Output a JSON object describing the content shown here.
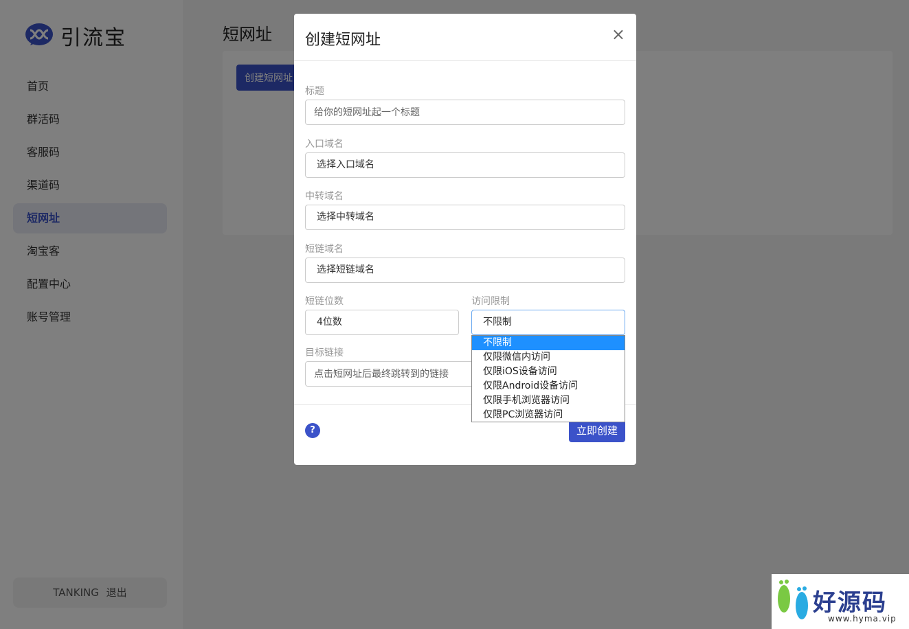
{
  "app": {
    "logo_text": "引流宝",
    "logo_colors": [
      "#3b52c9",
      "#1e2f8a"
    ]
  },
  "sidebar": {
    "items": [
      {
        "label": "首页"
      },
      {
        "label": "群活码"
      },
      {
        "label": "客服码"
      },
      {
        "label": "渠道码"
      },
      {
        "label": "短网址",
        "active": true
      },
      {
        "label": "淘宝客"
      },
      {
        "label": "配置中心"
      },
      {
        "label": "账号管理"
      }
    ],
    "user": {
      "name": "TANKING",
      "logout": "退出"
    }
  },
  "main": {
    "title": "短网址",
    "create_button": "创建短网址"
  },
  "modal": {
    "title": "创建短网址",
    "close_glyph": "×",
    "fields": {
      "title": {
        "label": "标题",
        "placeholder": "给你的短网址起一个标题"
      },
      "entry_domain": {
        "label": "入口域名",
        "value": "选择入口域名"
      },
      "transit_domain": {
        "label": "中转域名",
        "value": "选择中转域名"
      },
      "short_domain": {
        "label": "短链域名",
        "value": "选择短链域名"
      },
      "digits": {
        "label": "短链位数",
        "value": "4位数"
      },
      "access_limit": {
        "label": "访问限制",
        "value": "不限制",
        "options": [
          "不限制",
          "仅限微信内访问",
          "仅限iOS设备访问",
          "仅限Android设备访问",
          "仅限手机浏览器访问",
          "仅限PC浏览器访问"
        ]
      },
      "target_link": {
        "label": "目标链接",
        "placeholder": "点击短网址后最终跳转到的链接"
      }
    },
    "help_glyph": "?",
    "submit_button": "立即创建"
  },
  "watermark": {
    "text": "好源码",
    "url": "www.hyma.vip",
    "color": "#2b3f8f"
  },
  "colors": {
    "accent": "#3b52c9",
    "selected_option": "#1e90ff"
  }
}
